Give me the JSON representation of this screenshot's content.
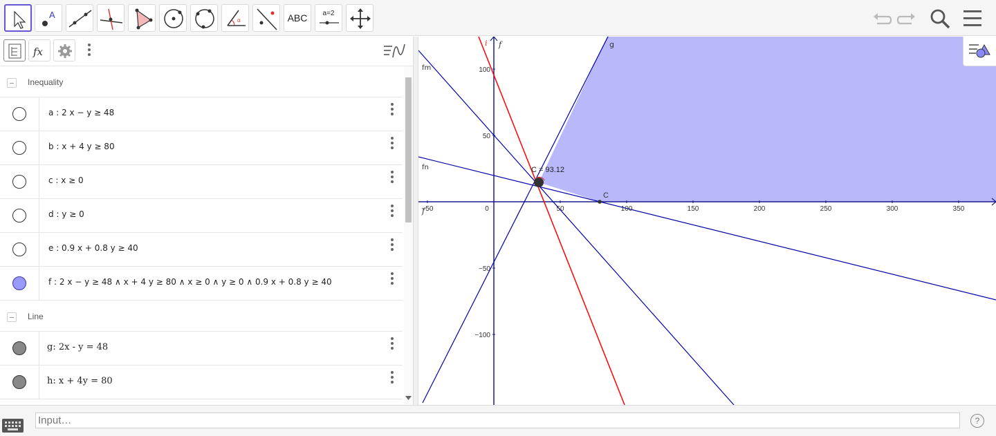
{
  "toolbar": {
    "tools": [
      {
        "name": "move-tool",
        "label": ""
      },
      {
        "name": "point-tool",
        "label": ""
      },
      {
        "name": "line-tool",
        "label": ""
      },
      {
        "name": "perpendicular-line-tool",
        "label": ""
      },
      {
        "name": "polygon-tool",
        "label": ""
      },
      {
        "name": "circle-center-point-tool",
        "label": ""
      },
      {
        "name": "circle-three-points-tool",
        "label": ""
      },
      {
        "name": "angle-tool",
        "label": ""
      },
      {
        "name": "reflect-tool",
        "label": ""
      },
      {
        "name": "text-tool",
        "label": "ABC"
      },
      {
        "name": "slider-tool",
        "label": "a=2"
      },
      {
        "name": "move-graphics-tool",
        "label": ""
      }
    ],
    "icons": [
      "undo-icon",
      "redo-icon",
      "search-icon",
      "menu-icon"
    ]
  },
  "algebra": {
    "header_icons": [
      "algebra-view-icon",
      "fx-icon",
      "gear-icon",
      "more-options-icon",
      "sort-icon"
    ],
    "groups": [
      {
        "label": "Inequality",
        "rows": [
          {
            "text": "a :  2 x − y ≥ 48",
            "marker": "empty"
          },
          {
            "text": "b :  x + 4 y ≥ 80",
            "marker": "empty"
          },
          {
            "text": "c :  x ≥ 0",
            "marker": "empty"
          },
          {
            "text": "d :  y ≥ 0",
            "marker": "empty"
          },
          {
            "text": "e :  0.9 x + 0.8 y ≥ 40",
            "marker": "empty"
          },
          {
            "text": "f :  2 x − y ≥ 48 ∧ x + 4 y ≥ 80 ∧ x ≥ 0 ∧ y ≥ 0 ∧ 0.9 x + 0.8 y ≥ 40",
            "marker": "blue"
          }
        ]
      },
      {
        "label": "Line",
        "rows": [
          {
            "text": "g: 2x - y = 48",
            "marker": "gray"
          },
          {
            "text": "h: x + 4y = 80",
            "marker": "gray"
          }
        ]
      }
    ]
  },
  "graphics": {
    "x_ticks": [
      "−50",
      "0",
      "50",
      "100",
      "150",
      "200",
      "250",
      "300",
      "350"
    ],
    "y_ticks": [
      "100",
      "50",
      "−50",
      "−100"
    ],
    "x_tick_values": [
      -50,
      0,
      50,
      100,
      150,
      200,
      250,
      300,
      350
    ],
    "y_tick_values": [
      100,
      50,
      -50,
      -100
    ],
    "line_labels": {
      "i": "i",
      "f": "f",
      "g": "g",
      "fm": "fm",
      "fn": "fn",
      "fj": "f"
    },
    "point_label": "C",
    "value_label": "C  = 93.12",
    "colors": {
      "axis": "#1a1a8c",
      "line": "#0000aa",
      "red_line": "#ff0000",
      "region": "#b8b8fb"
    }
  },
  "input": {
    "placeholder": "Input…"
  },
  "help": {
    "label": "?"
  }
}
